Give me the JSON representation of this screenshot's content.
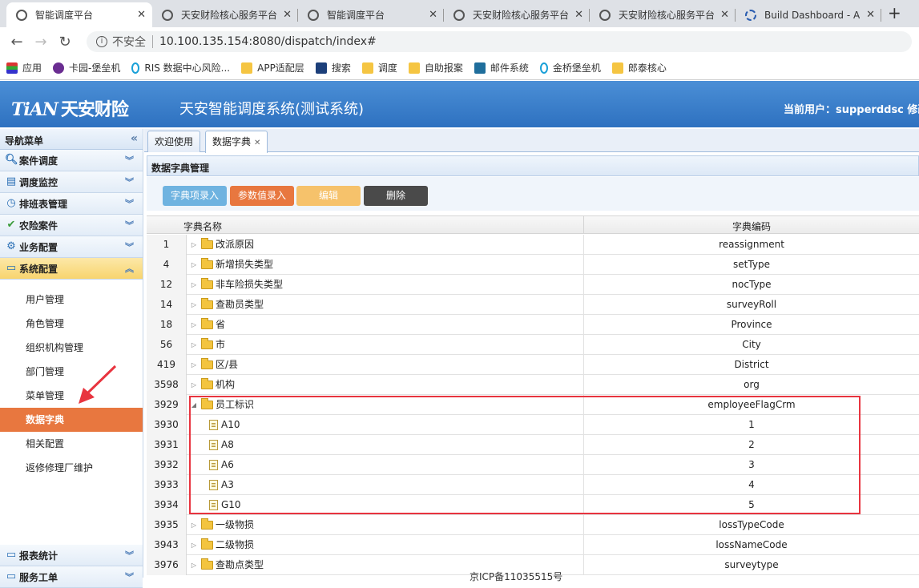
{
  "browser": {
    "tabs": [
      {
        "title": "智能调度平台",
        "active": true
      },
      {
        "title": "天安财险核心服务平台",
        "active": false
      },
      {
        "title": "智能调度平台",
        "active": false
      },
      {
        "title": "天安财险核心服务平台",
        "active": false
      },
      {
        "title": "天安财险核心服务平台",
        "active": false
      },
      {
        "title": "Build Dashboard - A",
        "active": false
      }
    ],
    "new_tab": "+",
    "security_label": "不安全",
    "url": "10.100.135.154:8080/dispatch/index#",
    "bookmarks": [
      {
        "label": "应用",
        "icon": "apps-grid-icon"
      },
      {
        "label": "卡园-堡垒机",
        "icon": "purple-logo-icon"
      },
      {
        "label": "RIS 数据中心风险...",
        "icon": "ring-logo-icon"
      },
      {
        "label": "APP适配层",
        "icon": "folder-icon"
      },
      {
        "label": "搜索",
        "icon": "search-logo-icon"
      },
      {
        "label": "调度",
        "icon": "folder-icon"
      },
      {
        "label": "自助报案",
        "icon": "folder-icon"
      },
      {
        "label": "邮件系统",
        "icon": "mail-logo-icon"
      },
      {
        "label": "金桥堡垒机",
        "icon": "ring-logo-icon"
      },
      {
        "label": "郎泰核心",
        "icon": "folder-icon"
      }
    ]
  },
  "app": {
    "logo_en": "TiAN",
    "logo_cn": "天安财险",
    "system_name": "天安智能调度系统(测试系统)",
    "current_user": "当前用户：supperddsc  修改"
  },
  "sidebar": {
    "title": "导航菜单",
    "sections": [
      {
        "label": "案件调度",
        "icon": "search-icon",
        "open": false
      },
      {
        "label": "调度监控",
        "icon": "document-icon",
        "open": false
      },
      {
        "label": "排班表管理",
        "icon": "clock-icon",
        "open": false
      },
      {
        "label": "农险案件",
        "icon": "check-icon",
        "open": false
      },
      {
        "label": "业务配置",
        "icon": "gear-icon",
        "open": false
      },
      {
        "label": "系统配置",
        "icon": "monitor-icon",
        "open": true
      }
    ],
    "sub_items": [
      "用户管理",
      "角色管理",
      "组织机构管理",
      "部门管理",
      "菜单管理",
      "数据字典",
      "相关配置",
      "返修修理厂维护"
    ],
    "active_sub": "数据字典",
    "bottom_sections": [
      {
        "label": "报表统计",
        "icon": "monitor-icon"
      },
      {
        "label": "服务工单",
        "icon": "monitor-icon"
      }
    ]
  },
  "main": {
    "tabs": [
      {
        "label": "欢迎使用",
        "active": false
      },
      {
        "label": "数据字典",
        "active": true
      }
    ],
    "panel_title": "数据字典管理",
    "buttons": [
      {
        "label": "字典项录入",
        "color": "#6fb3e0"
      },
      {
        "label": "参数值录入",
        "color": "#e8773f"
      },
      {
        "label": "编辑",
        "color": "#f6c26b"
      },
      {
        "label": "删除",
        "color": "#4a4a4a"
      }
    ],
    "columns": [
      "字典名称",
      "字典编码"
    ],
    "rows": [
      {
        "id": "1",
        "name": "改派原因",
        "code": "reassignment",
        "type": "folder",
        "expanded": false
      },
      {
        "id": "4",
        "name": "新增损失类型",
        "code": "setType",
        "type": "folder",
        "expanded": false
      },
      {
        "id": "12",
        "name": "非车险损失类型",
        "code": "nocType",
        "type": "folder",
        "expanded": false
      },
      {
        "id": "14",
        "name": "查勘员类型",
        "code": "surveyRoll",
        "type": "folder",
        "expanded": false
      },
      {
        "id": "18",
        "name": "省",
        "code": "Province",
        "type": "folder",
        "expanded": false
      },
      {
        "id": "56",
        "name": "市",
        "code": "City",
        "type": "folder",
        "expanded": false
      },
      {
        "id": "419",
        "name": "区/县",
        "code": "District",
        "type": "folder",
        "expanded": false
      },
      {
        "id": "3598",
        "name": "机构",
        "code": "org",
        "type": "folder",
        "expanded": false
      },
      {
        "id": "3929",
        "name": "员工标识",
        "code": "employeeFlagCrm",
        "type": "folder",
        "expanded": true
      },
      {
        "id": "3930",
        "name": "A10",
        "code": "1",
        "type": "leaf"
      },
      {
        "id": "3931",
        "name": "A8",
        "code": "2",
        "type": "leaf"
      },
      {
        "id": "3932",
        "name": "A6",
        "code": "3",
        "type": "leaf"
      },
      {
        "id": "3933",
        "name": "A3",
        "code": "4",
        "type": "leaf"
      },
      {
        "id": "3934",
        "name": "G10",
        "code": "5",
        "type": "leaf"
      },
      {
        "id": "3935",
        "name": "一级物损",
        "code": "lossTypeCode",
        "type": "folder",
        "expanded": false
      },
      {
        "id": "3943",
        "name": "二级物损",
        "code": "lossNameCode",
        "type": "folder",
        "expanded": false
      },
      {
        "id": "3976",
        "name": "查勘点类型",
        "code": "surveytype",
        "type": "folder",
        "expanded": false
      }
    ],
    "footer_text": "京ICP备11035515号"
  }
}
